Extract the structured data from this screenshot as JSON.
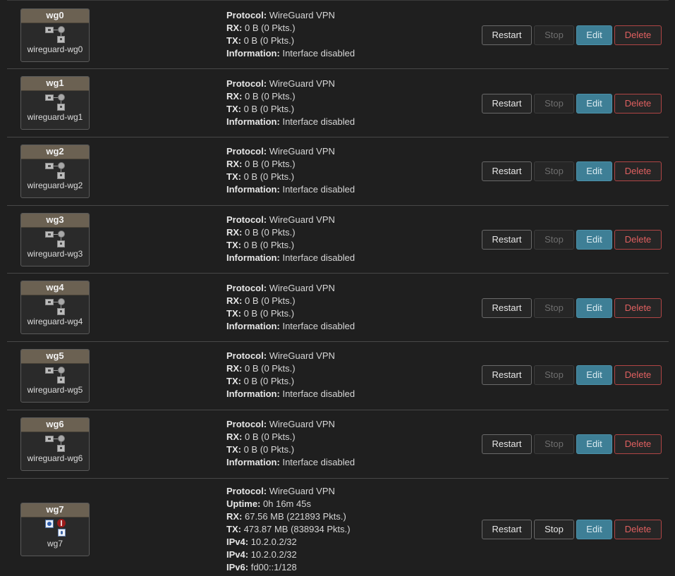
{
  "buttons": {
    "restart": "Restart",
    "stop": "Stop",
    "edit": "Edit",
    "delete": "Delete"
  },
  "labels": {
    "protocol": "Protocol:",
    "rx": "RX:",
    "tx": "TX:",
    "information": "Information:",
    "uptime": "Uptime:",
    "ipv4": "IPv4:",
    "ipv6": "IPv6:"
  },
  "interfaces": [
    {
      "name": "wg0",
      "device": "wireguard-wg0",
      "protocol": "WireGuard VPN",
      "rx": "0 B (0 Pkts.)",
      "tx": "0 B (0 Pkts.)",
      "information": "Interface disabled"
    },
    {
      "name": "wg1",
      "device": "wireguard-wg1",
      "protocol": "WireGuard VPN",
      "rx": "0 B (0 Pkts.)",
      "tx": "0 B (0 Pkts.)",
      "information": "Interface disabled"
    },
    {
      "name": "wg2",
      "device": "wireguard-wg2",
      "protocol": "WireGuard VPN",
      "rx": "0 B (0 Pkts.)",
      "tx": "0 B (0 Pkts.)",
      "information": "Interface disabled"
    },
    {
      "name": "wg3",
      "device": "wireguard-wg3",
      "protocol": "WireGuard VPN",
      "rx": "0 B (0 Pkts.)",
      "tx": "0 B (0 Pkts.)",
      "information": "Interface disabled"
    },
    {
      "name": "wg4",
      "device": "wireguard-wg4",
      "protocol": "WireGuard VPN",
      "rx": "0 B (0 Pkts.)",
      "tx": "0 B (0 Pkts.)",
      "information": "Interface disabled"
    },
    {
      "name": "wg5",
      "device": "wireguard-wg5",
      "protocol": "WireGuard VPN",
      "rx": "0 B (0 Pkts.)",
      "tx": "0 B (0 Pkts.)",
      "information": "Interface disabled"
    },
    {
      "name": "wg6",
      "device": "wireguard-wg6",
      "protocol": "WireGuard VPN",
      "rx": "0 B (0 Pkts.)",
      "tx": "0 B (0 Pkts.)",
      "information": "Interface disabled"
    },
    {
      "name": "wg7",
      "device": "wg7",
      "protocol": "WireGuard VPN",
      "uptime": "0h 16m 45s",
      "rx": "67.56 MB (221893 Pkts.)",
      "tx": "473.87 MB (838934 Pkts.)",
      "ipv4": [
        "10.2.0.2/32",
        "10.2.0.2/32"
      ],
      "ipv6": "fd00::1/128"
    }
  ],
  "colors": {
    "edit": "#3e7f96",
    "delete_text": "#e06060",
    "badge_head": "#6b6152",
    "background": "#1f1f1f"
  },
  "icons": {
    "disabled": "network-device-icon-disabled",
    "active": "network-device-icon-active"
  }
}
